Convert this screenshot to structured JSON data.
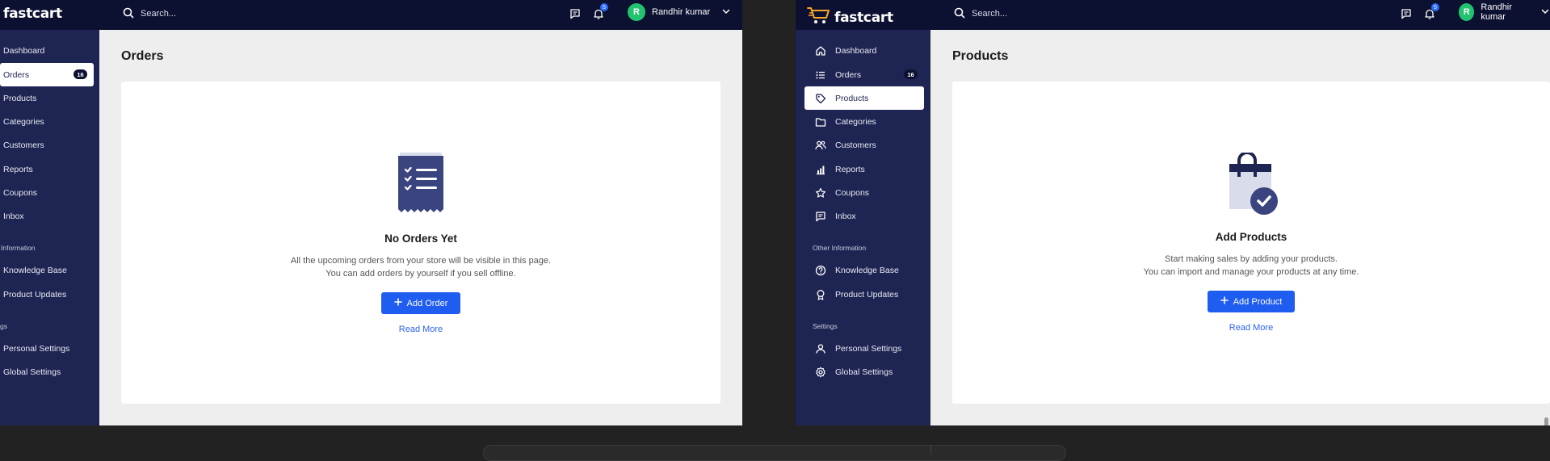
{
  "left": {
    "header": {
      "brand": "fastcart",
      "search_placeholder": "Search...",
      "notification_count": "5",
      "avatar_initial": "R",
      "user_name": "Randhir kumar"
    },
    "sidebar": {
      "items": [
        {
          "label": "Dashboard"
        },
        {
          "label": "Orders",
          "count": "16"
        },
        {
          "label": "Products"
        },
        {
          "label": "Categories"
        },
        {
          "label": "Customers"
        },
        {
          "label": "Reports"
        },
        {
          "label": "Coupons"
        },
        {
          "label": "Inbox"
        }
      ],
      "section_info": "Information",
      "info_items": [
        {
          "label": "Knowledge Base"
        },
        {
          "label": "Product Updates"
        }
      ],
      "section_settings": "gs",
      "settings_items": [
        {
          "label": "Personal Settings"
        },
        {
          "label": "Global Settings"
        }
      ]
    },
    "main": {
      "title": "Orders",
      "empty_title": "No Orders Yet",
      "empty_line1": "All the upcoming orders from your store will be visible in this page.",
      "empty_line2": "You can add orders by yourself if you sell offline.",
      "button_label": "Add Order",
      "read_more": "Read More"
    }
  },
  "right": {
    "header": {
      "brand": "fastcart",
      "search_placeholder": "Search...",
      "notification_count": "5",
      "avatar_initial": "R",
      "user_name": "Randhir kumar"
    },
    "sidebar": {
      "items": [
        {
          "label": "Dashboard",
          "icon": "home-icon"
        },
        {
          "label": "Orders",
          "icon": "list-icon",
          "count": "16"
        },
        {
          "label": "Products",
          "icon": "tag-icon"
        },
        {
          "label": "Categories",
          "icon": "folder-icon"
        },
        {
          "label": "Customers",
          "icon": "users-icon"
        },
        {
          "label": "Reports",
          "icon": "bar-chart-icon"
        },
        {
          "label": "Coupons",
          "icon": "star-icon"
        },
        {
          "label": "Inbox",
          "icon": "message-icon"
        }
      ],
      "section_info": "Other Information",
      "info_items": [
        {
          "label": "Knowledge Base",
          "icon": "help-circle-icon"
        },
        {
          "label": "Product Updates",
          "icon": "award-icon"
        }
      ],
      "section_settings": "Settings",
      "settings_items": [
        {
          "label": "Personal Settings",
          "icon": "user-icon"
        },
        {
          "label": "Global Settings",
          "icon": "gear-icon"
        }
      ]
    },
    "main": {
      "title": "Products",
      "empty_title": "Add Products",
      "empty_line1": "Start making sales by adding your products.",
      "empty_line2": "You can import and manage your products at any time.",
      "button_label": "Add Product",
      "read_more": "Read More"
    }
  },
  "colors": {
    "topbar": "#0d1131",
    "sidebar": "#1f2552",
    "primary": "#1f5cf0",
    "avatar": "#22c36e",
    "link": "#2a63f0"
  }
}
